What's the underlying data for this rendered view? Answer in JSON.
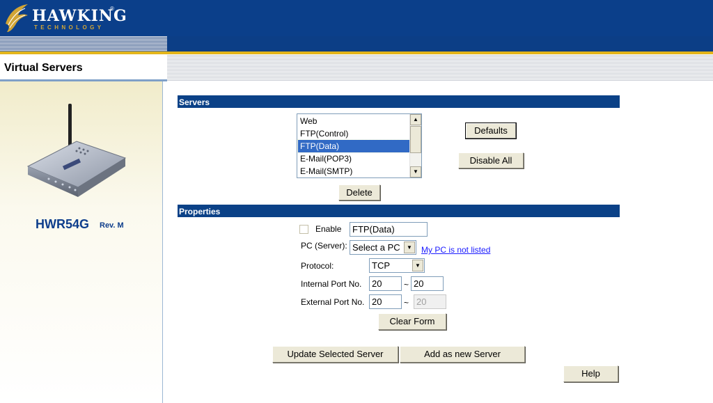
{
  "header": {
    "brand": "HAWKING",
    "brand_sub": "TECHNOLOGY",
    "registered": "®",
    "colors": {
      "header_blue": "#0b3f8a",
      "gold": "#e3b51b",
      "section_blue": "#0b4187"
    }
  },
  "page": {
    "title": "Virtual Servers"
  },
  "sidebar": {
    "model": "HWR54G",
    "revision": "Rev. M"
  },
  "servers": {
    "section_title": "Servers",
    "list": [
      "Web",
      "FTP(Control)",
      "FTP(Data)",
      "E-Mail(POP3)",
      "E-Mail(SMTP)"
    ],
    "selected": "FTP(Data)",
    "defaults_label": "Defaults",
    "disable_all_label": "Disable All",
    "delete_label": "Delete"
  },
  "properties": {
    "section_title": "Properties",
    "enable_label": "Enable",
    "enable_checked": false,
    "server_name": "FTP(Data)",
    "pc_label": "PC (Server):",
    "pc_value": "Select a PC",
    "pc_link": "My PC is not listed",
    "protocol_label": "Protocol:",
    "protocol_value": "TCP",
    "internal_port_label": "Internal Port No.",
    "internal_port_start": "20",
    "internal_port_end": "20",
    "external_port_label": "External Port No.",
    "external_port_start": "20",
    "external_port_end": "20",
    "tilde": "~",
    "clear_form_label": "Clear Form",
    "update_label": "Update Selected Server",
    "add_label": "Add as new Server",
    "help_label": "Help"
  }
}
